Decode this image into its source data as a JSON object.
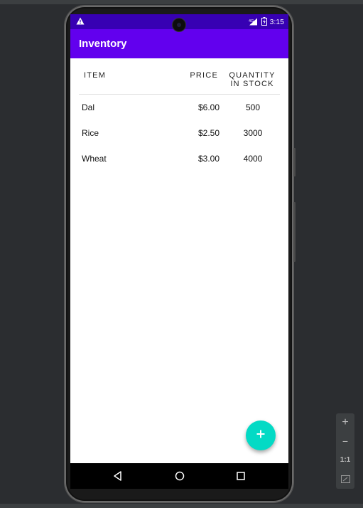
{
  "app": {
    "title": "Inventory"
  },
  "status_bar": {
    "time": "3:15",
    "network": "4G",
    "icons": [
      "warning-icon",
      "signal-icon",
      "battery-icon"
    ]
  },
  "table": {
    "headers": {
      "item": "ITEM",
      "price": "PRICE",
      "quantity_line1": "QUANTITY",
      "quantity_line2": "IN STOCK"
    },
    "rows": [
      {
        "item": "Dal",
        "price": "$6.00",
        "quantity": "500"
      },
      {
        "item": "Rice",
        "price": "$2.50",
        "quantity": "3000"
      },
      {
        "item": "Wheat",
        "price": "$3.00",
        "quantity": "4000"
      }
    ]
  },
  "fab": {
    "icon": "add-icon",
    "glyph": "+"
  },
  "navbar": {
    "icons": [
      "back-icon",
      "home-icon",
      "recents-icon"
    ]
  },
  "emulator_zoom": {
    "zoom_in": "+",
    "zoom_out": "−",
    "actual_size": "1:1",
    "fit_icon": "fit-screen-icon"
  },
  "colors": {
    "status_bar": "#3700b3",
    "app_bar": "#6200ee",
    "fab": "#03dac5"
  }
}
